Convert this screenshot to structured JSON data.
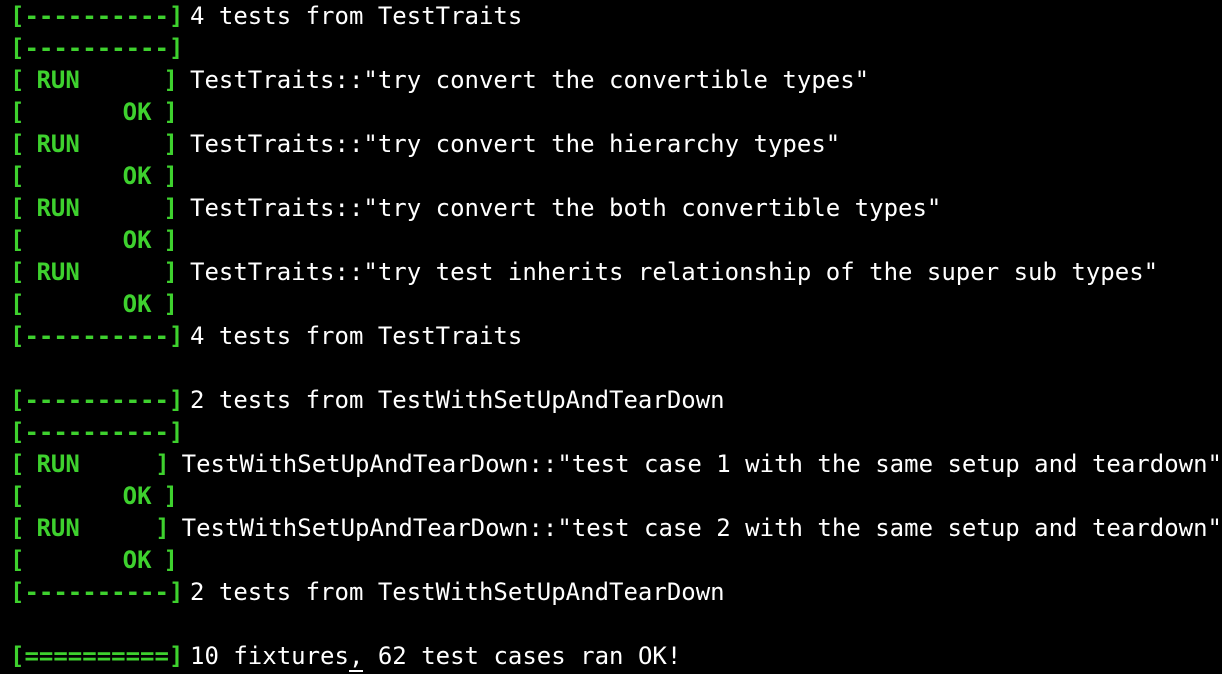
{
  "terminal": {
    "colors": {
      "background": "#000000",
      "tag": "#3ed12e",
      "text": "#ffffff"
    },
    "separator_tag": "[----------]",
    "pass_tag": "[==========]",
    "run_label": "RUN",
    "ok_label": "OK",
    "bracket_open": "[",
    "bracket_close": "]",
    "lines": {
      "l1": "4 tests from TestTraits",
      "l3": "TestTraits::\"try convert the convertible types\"",
      "l5": "TestTraits::\"try convert the hierarchy types\"",
      "l7": "TestTraits::\"try convert the both convertible types\"",
      "l9": "TestTraits::\"try test inherits relationship of the super sub types\"",
      "l11": "4 tests from TestTraits",
      "l13": "2 tests from TestWithSetUpAndTearDown",
      "l15": "TestWithSetUpAndTearDown::\"test case 1 with the same setup and teardown\"",
      "l17": "TestWithSetUpAndTearDown::\"test case 2 with the same setup and teardown\"",
      "l19": "2 tests from TestWithSetUpAndTearDown",
      "summary_before": "10 fixtures",
      "summary_comma": ",",
      "summary_after": " 62 test cases ran OK!"
    }
  }
}
